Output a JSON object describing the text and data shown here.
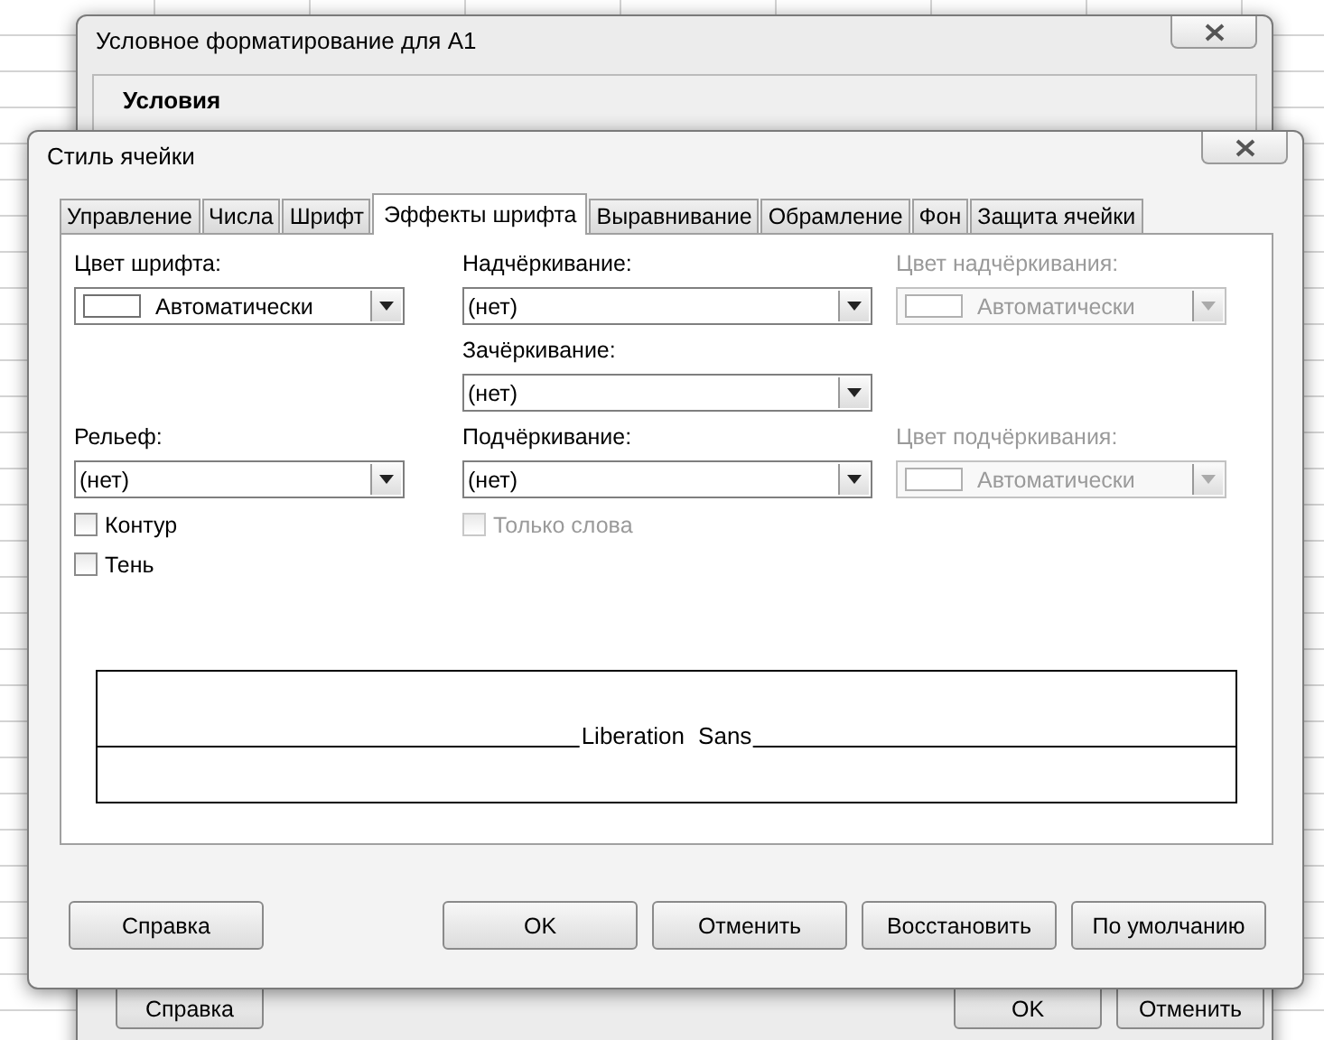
{
  "back_window": {
    "title": "Условное форматирование для A1",
    "section": "Условия",
    "buttons": [
      "Справка",
      "OK",
      "Отменить"
    ]
  },
  "window": {
    "title": "Стиль ячейки"
  },
  "tabs": [
    {
      "label": "Управление",
      "selected": false
    },
    {
      "label": "Числа",
      "selected": false
    },
    {
      "label": "Шрифт",
      "selected": false
    },
    {
      "label": "Эффекты шрифта",
      "selected": true
    },
    {
      "label": "Выравнивание",
      "selected": false
    },
    {
      "label": "Обрамление",
      "selected": false
    },
    {
      "label": "Фон",
      "selected": false
    },
    {
      "label": "Защита ячейки",
      "selected": false
    }
  ],
  "rows": [
    {
      "column_1": [
        {
          "kind": "colorpicker",
          "label": "Цвет шрифта:",
          "value": "Автоматически",
          "disabled": false
        }
      ],
      "column_2": [
        {
          "kind": "dropdown",
          "label": "Надчёркивание:",
          "value": "(нет)",
          "disabled": false
        }
      ],
      "column_3": [
        {
          "kind": "colorpicker",
          "label": "Цвет надчёркивания:",
          "value": "Автоматически",
          "disabled": true
        }
      ]
    },
    {
      "column_2": [
        {
          "kind": "dropdown",
          "label": "Зачёркивание:",
          "value": "(нет)",
          "disabled": false
        }
      ]
    },
    {
      "column_1": [
        {
          "kind": "dropdown",
          "label": "Рельеф:",
          "value": "(нет)",
          "disabled": false
        }
      ],
      "column_2": [
        {
          "kind": "dropdown",
          "label": "Подчёркивание:",
          "value": "(нет)",
          "disabled": false
        }
      ],
      "column_3": [
        {
          "kind": "colorpicker",
          "label": "Цвет подчёркивания:",
          "value": "Автоматически",
          "disabled": true
        }
      ]
    },
    {
      "column_1": [
        {
          "kind": "checkbox",
          "label": "Контур",
          "checked": false,
          "disabled": false
        },
        {
          "kind": "checkbox",
          "label": "Тень",
          "checked": false,
          "disabled": false
        }
      ],
      "column_2": [
        {
          "kind": "checkbox",
          "label": "Только слова",
          "checked": false,
          "disabled": true
        }
      ]
    }
  ],
  "preview": {
    "text": "Liberation Sans"
  },
  "buttons": {
    "left": [
      "Справка"
    ],
    "right": [
      "OK",
      "Отменить",
      "Восстановить",
      "По умолчанию"
    ]
  }
}
